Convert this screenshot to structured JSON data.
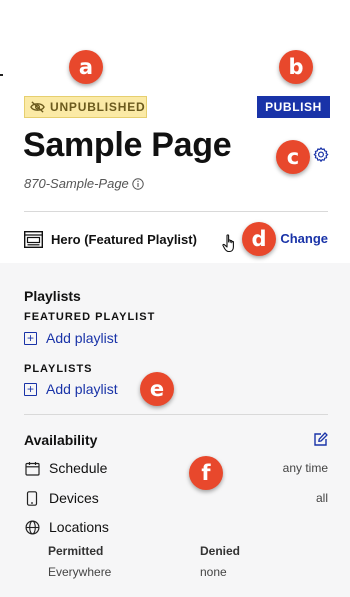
{
  "callouts": [
    "a",
    "b",
    "c",
    "d",
    "e",
    "f"
  ],
  "status_badge": {
    "label": "UNPUBLISHED",
    "icon": "eye-off-icon"
  },
  "publish_button": {
    "label": "PUBLISH"
  },
  "page": {
    "title": "Sample Page",
    "slug": "870-Sample-Page"
  },
  "template": {
    "name": "Hero (Featured Playlist)",
    "change_label": "Change"
  },
  "playlists": {
    "heading": "Playlists",
    "featured_label": "FEATURED PLAYLIST",
    "featured_add": "Add playlist",
    "playlists_label": "PLAYLISTS",
    "playlists_add": "Add playlist"
  },
  "availability": {
    "heading": "Availability",
    "rows": [
      {
        "label": "Schedule",
        "value": "any time",
        "icon": "calendar-icon"
      },
      {
        "label": "Devices",
        "value": "all",
        "icon": "device-icon"
      },
      {
        "label": "Locations",
        "value": "",
        "icon": "globe-icon"
      }
    ],
    "locations": {
      "permitted_label": "Permitted",
      "permitted_value": "Everywhere",
      "denied_label": "Denied",
      "denied_value": "none"
    }
  },
  "colors": {
    "accent": "#1933a8",
    "callout": "#e8482c",
    "badge_bg": "#fbeaa6"
  }
}
